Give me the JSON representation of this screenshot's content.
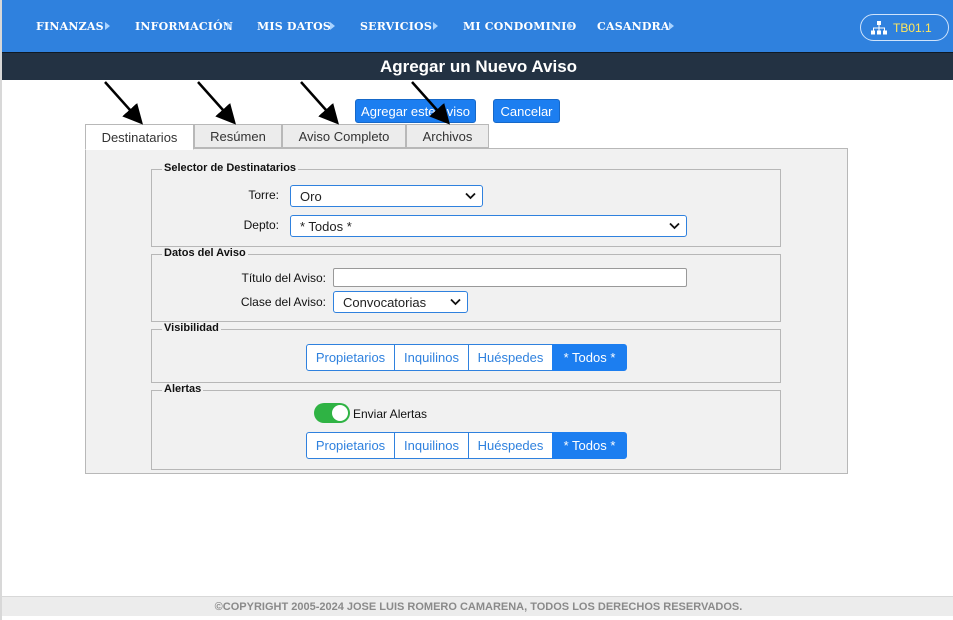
{
  "nav": {
    "items": [
      {
        "label": "FINANZAS"
      },
      {
        "label": "INFORMACIÓN"
      },
      {
        "label": "MIS DATOS"
      },
      {
        "label": "SERVICIOS"
      },
      {
        "label": "MI CONDOMINIO"
      },
      {
        "label": "CASANDRA"
      }
    ],
    "user_code": "TB01.1"
  },
  "page": {
    "title": "Agregar un Nuevo Aviso"
  },
  "actions": {
    "add_label": "Agregar este Aviso",
    "cancel_label": "Cancelar"
  },
  "tabs": [
    {
      "label": "Destinatarios",
      "active": true
    },
    {
      "label": "Resúmen",
      "active": false
    },
    {
      "label": "Aviso Completo",
      "active": false
    },
    {
      "label": "Archivos",
      "active": false
    }
  ],
  "recipients": {
    "legend": "Selector de Destinatarios",
    "tower_label": "Torre:",
    "tower_value": "Oro",
    "dept_label": "Depto:",
    "dept_value": "* Todos *"
  },
  "notice": {
    "legend": "Datos del Aviso",
    "title_label": "Título del Aviso:",
    "title_value": "",
    "class_label": "Clase del Aviso:",
    "class_value": "Convocatorias"
  },
  "visibility": {
    "legend": "Visibilidad",
    "options": [
      "Propietarios",
      "Inquilinos",
      "Huéspedes",
      "* Todos *"
    ],
    "selected": "* Todos *"
  },
  "alerts": {
    "legend": "Alertas",
    "toggle_label": "Enviar Alertas",
    "toggle_on": true,
    "options": [
      "Propietarios",
      "Inquilinos",
      "Huéspedes",
      "* Todos *"
    ],
    "selected": "* Todos *"
  },
  "footer": {
    "text": "©COPYRIGHT 2005-2024 JOSE LUIS ROMERO CAMARENA, TODOS LOS DERECHOS RESERVADOS."
  },
  "colors": {
    "nav_bg": "#2f81de",
    "title_bg": "#233243",
    "accent": "#1c7ef0",
    "toggle_on": "#2fb344",
    "user_code": "#ffe65c"
  }
}
